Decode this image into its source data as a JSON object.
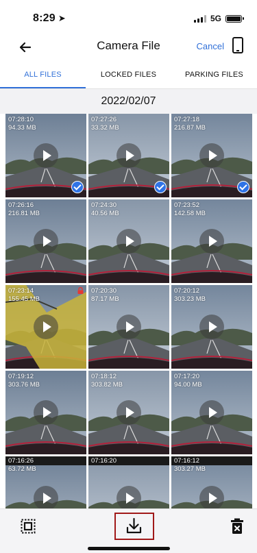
{
  "status_bar": {
    "time": "8:29",
    "network": "5G"
  },
  "nav": {
    "title": "Camera File",
    "cancel_label": "Cancel"
  },
  "tabs": [
    {
      "label": "ALL FILES",
      "active": true
    },
    {
      "label": "LOCKED FILES",
      "active": false
    },
    {
      "label": "PARKING FILES",
      "active": false
    }
  ],
  "date_header": "2022/02/07",
  "thumbnails": [
    {
      "time": "07:28:10",
      "size": "94.33 MB",
      "checked": true
    },
    {
      "time": "07:27:26",
      "size": "33.32 MB",
      "checked": true
    },
    {
      "time": "07:27:18",
      "size": "216.87 MB",
      "checked": true
    },
    {
      "time": "07:26:16",
      "size": "216.81 MB"
    },
    {
      "time": "07:24:30",
      "size": "40.56 MB"
    },
    {
      "time": "07:23:52",
      "size": "142.58 MB"
    },
    {
      "time": "07:23:14",
      "size": "155.45 MB",
      "locked": true
    },
    {
      "time": "07:20:30",
      "size": "87.17 MB"
    },
    {
      "time": "07:20:12",
      "size": "303.23 MB"
    },
    {
      "time": "07:19:12",
      "size": "303.76 MB"
    },
    {
      "time": "07:18:12",
      "size": "303.82 MB"
    },
    {
      "time": "07:17:20",
      "size": "94.00 MB"
    },
    {
      "time": "07:16:26",
      "size": "63.72 MB"
    },
    {
      "time": "07:16:20",
      "size": ""
    },
    {
      "time": "07:16:12",
      "size": "303.27 MB"
    }
  ],
  "colors": {
    "accent": "#2f6fd8",
    "highlight_border": "#a01818",
    "check": "#2f73e6",
    "lock": "#e53935"
  },
  "toolbar": {
    "icons": [
      "select-all-icon",
      "download-icon",
      "delete-icon"
    ]
  }
}
